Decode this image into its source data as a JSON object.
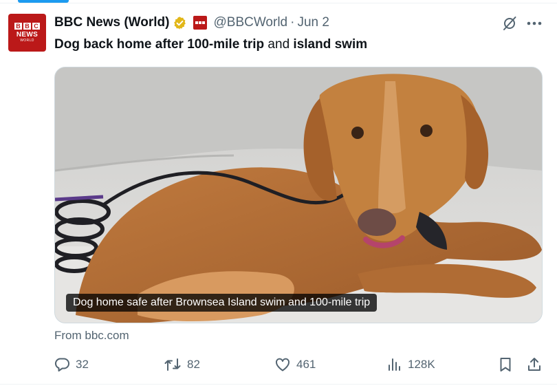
{
  "tweet": {
    "author": {
      "display_name": "BBC News (World)",
      "handle": "@BBCWorld",
      "avatar": {
        "bbc_letters": [
          "B",
          "B",
          "C"
        ],
        "line1": "NEWS",
        "line2": "WORLD"
      }
    },
    "separator": "·",
    "date": "Jun 2",
    "text_parts": {
      "part1": "Dog back home after 100-mile trip",
      "part2": " and ",
      "part3": "island swim"
    },
    "card": {
      "caption": "Dog home safe after Brownsea Island swim and 100-mile trip",
      "source": "From bbc.com"
    },
    "actions": {
      "replies": "32",
      "reposts": "82",
      "likes": "461",
      "views": "128K"
    }
  },
  "icons": [
    "verified-badge-icon",
    "affiliate-badge-icon",
    "grok-icon",
    "more-icon",
    "reply-icon",
    "repost-icon",
    "like-icon",
    "views-icon",
    "bookmark-icon",
    "share-icon"
  ],
  "colors": {
    "accent": "#1d9bf0",
    "brand_red": "#bb1919",
    "verified_gold": "#e2b719",
    "text_primary": "#0f1419",
    "text_secondary": "#536471"
  }
}
